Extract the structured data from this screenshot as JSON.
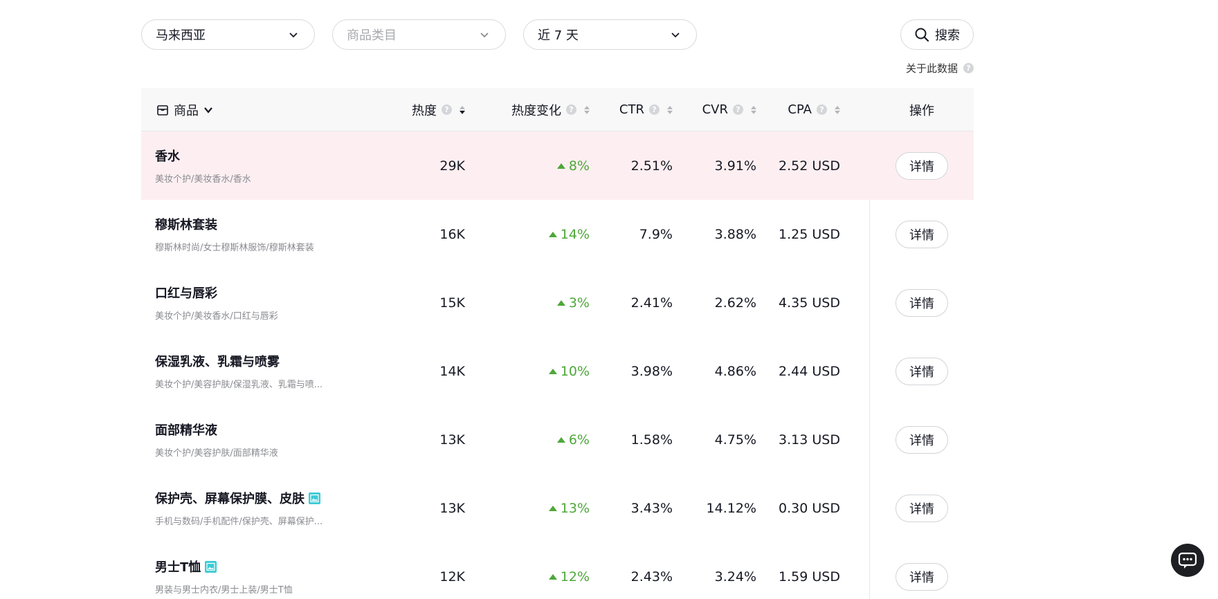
{
  "filters": {
    "region": {
      "value": "马来西亚"
    },
    "category": {
      "placeholder": "商品类目"
    },
    "period": {
      "value": "近 7 天"
    },
    "search_label": "搜索"
  },
  "about_label": "关于此数据",
  "table": {
    "headers": {
      "product": "商品",
      "heat": "热度",
      "heat_change": "热度变化",
      "ctr": "CTR",
      "cvr": "CVR",
      "cpa": "CPA",
      "action": "操作"
    },
    "rows": [
      {
        "name": "香水",
        "path": "美妆个护/美妆香水/香水",
        "heat": "29K",
        "change": "8%",
        "ctr": "2.51%",
        "cvr": "3.91%",
        "cpa": "2.52 USD",
        "action": "详情"
      },
      {
        "name": "穆斯林套装",
        "path": "穆斯林时尚/女士穆斯林服饰/穆斯林套装",
        "heat": "16K",
        "change": "14%",
        "ctr": "7.9%",
        "cvr": "3.88%",
        "cpa": "1.25 USD",
        "action": "详情"
      },
      {
        "name": "口红与唇彩",
        "path": "美妆个护/美妆香水/口红与唇彩",
        "heat": "15K",
        "change": "3%",
        "ctr": "2.41%",
        "cvr": "2.62%",
        "cpa": "4.35 USD",
        "action": "详情"
      },
      {
        "name": "保湿乳液、乳霜与喷雾",
        "path": "美妆个护/美容护肤/保湿乳液、乳霜与喷...",
        "heat": "14K",
        "change": "10%",
        "ctr": "3.98%",
        "cvr": "4.86%",
        "cpa": "2.44 USD",
        "action": "详情"
      },
      {
        "name": "面部精华液",
        "path": "美妆个护/美容护肤/面部精华液",
        "heat": "13K",
        "change": "6%",
        "ctr": "1.58%",
        "cvr": "4.75%",
        "cpa": "3.13 USD",
        "action": "详情"
      },
      {
        "name": "保护壳、屏幕保护膜、皮肤",
        "path": "手机与数码/手机配件/保护壳、屏幕保护...",
        "heat": "13K",
        "change": "13%",
        "ctr": "3.43%",
        "cvr": "14.12%",
        "cpa": "0.30 USD",
        "action": "详情"
      },
      {
        "name": "男士T恤",
        "path": "男装与男士内衣/男士上装/男士T恤",
        "heat": "12K",
        "change": "12%",
        "ctr": "2.43%",
        "cvr": "3.24%",
        "cpa": "1.59 USD",
        "action": "详情"
      }
    ]
  },
  "colors": {
    "highlight_row": "#fdeff1",
    "positive_change": "#4ea73a"
  },
  "icons": {
    "dropdown": "chevron-down-icon",
    "search": "search-icon",
    "product_column": "bag-icon",
    "image_badge": "image-icon",
    "chat": "chat-icon"
  }
}
